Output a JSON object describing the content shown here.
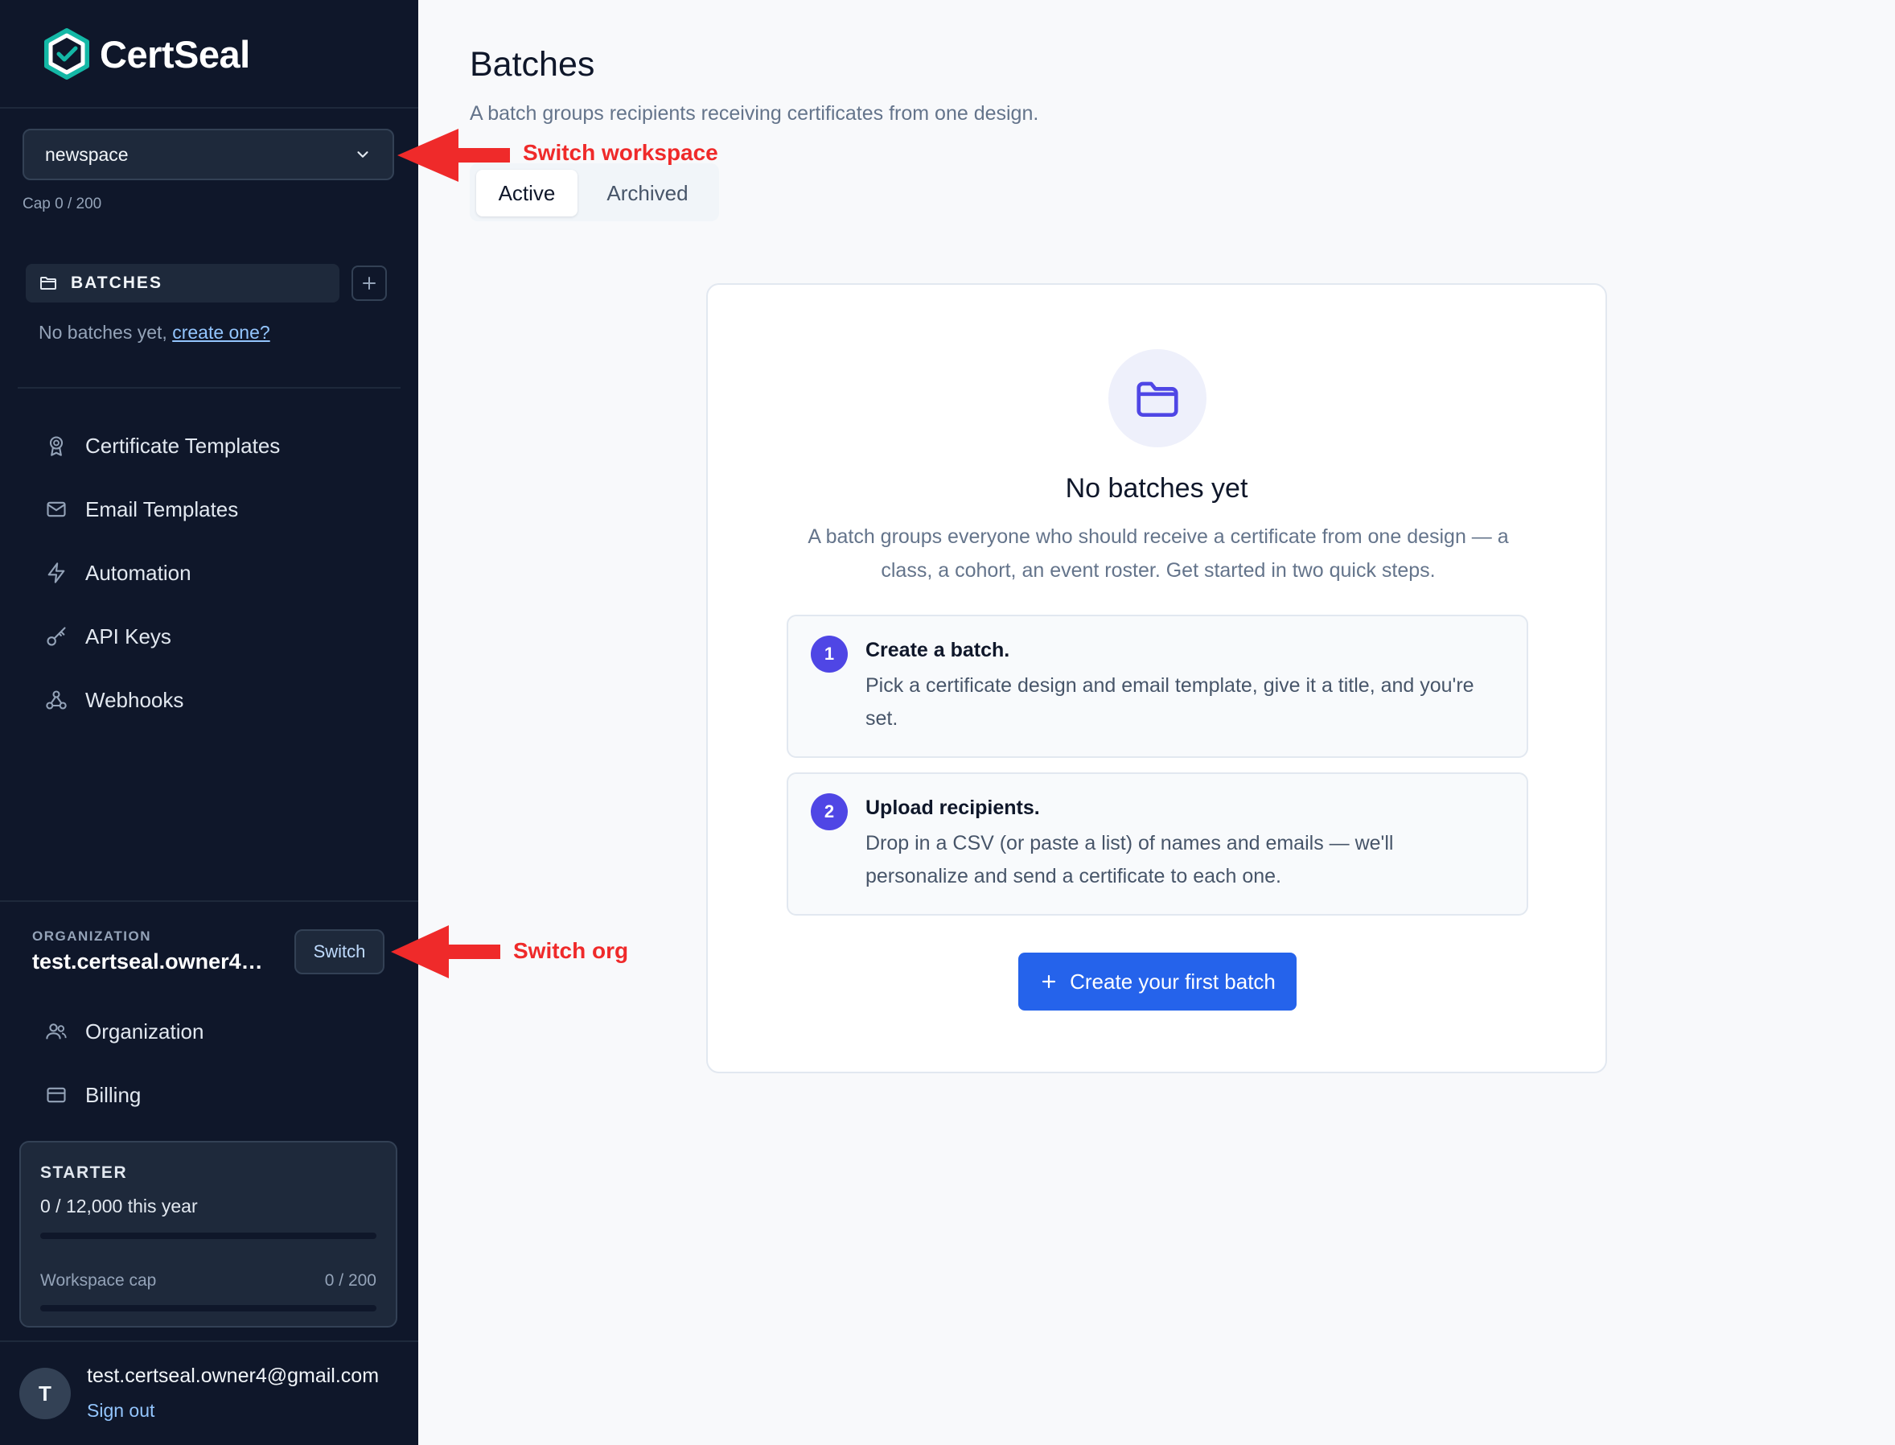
{
  "app": {
    "name": "CertSeal"
  },
  "workspace": {
    "selected": "newspace",
    "cap": "Cap 0 / 200"
  },
  "batches_section": {
    "label": "BATCHES",
    "empty_prefix": "No batches yet, ",
    "empty_link": "create one?"
  },
  "nav": [
    {
      "label": "Certificate Templates",
      "icon": "award-icon"
    },
    {
      "label": "Email Templates",
      "icon": "mail-icon"
    },
    {
      "label": "Automation",
      "icon": "zap-icon"
    },
    {
      "label": "API Keys",
      "icon": "key-icon"
    },
    {
      "label": "Webhooks",
      "icon": "webhook-icon"
    }
  ],
  "organization": {
    "caption": "ORGANIZATION",
    "name": "test.certseal.owner4@g...",
    "switch_label": "Switch"
  },
  "org_nav": [
    {
      "label": "Organization",
      "icon": "users-icon"
    },
    {
      "label": "Billing",
      "icon": "credit-card-icon"
    }
  ],
  "plan": {
    "name": "STARTER",
    "usage": "0 / 12,000 this year",
    "usage_fraction": 0,
    "ws_cap_label": "Workspace cap",
    "ws_cap_value": "0 / 200",
    "ws_cap_fraction": 0
  },
  "user": {
    "initial": "T",
    "email": "test.certseal.owner4@gmail.com",
    "sign_out": "Sign out"
  },
  "main": {
    "title": "Batches",
    "subtitle": "A batch groups recipients receiving certificates from one design.",
    "tabs": [
      {
        "label": "Active",
        "active": true
      },
      {
        "label": "Archived",
        "active": false
      }
    ]
  },
  "empty_state": {
    "title": "No batches yet",
    "description": "A batch groups everyone who should receive a certificate from one design — a class, a cohort, an event roster. Get started in two quick steps.",
    "steps": [
      {
        "num": "1",
        "title": "Create a batch.",
        "text": "Pick a certificate design and email template, give it a title, and you're set."
      },
      {
        "num": "2",
        "title": "Upload recipients.",
        "text": "Drop in a CSV (or paste a list) of names and emails — we'll personalize and send a certificate to each one."
      }
    ],
    "cta": "Create your first batch"
  },
  "annotations": {
    "workspace": "Switch workspace",
    "org": "Switch org"
  },
  "colors": {
    "sidebar_bg": "#0f172a",
    "accent": "#2563eb",
    "step_badge": "#4f46e5",
    "annotation": "#ef2a2a",
    "logo_teal": "#14b8a6"
  }
}
